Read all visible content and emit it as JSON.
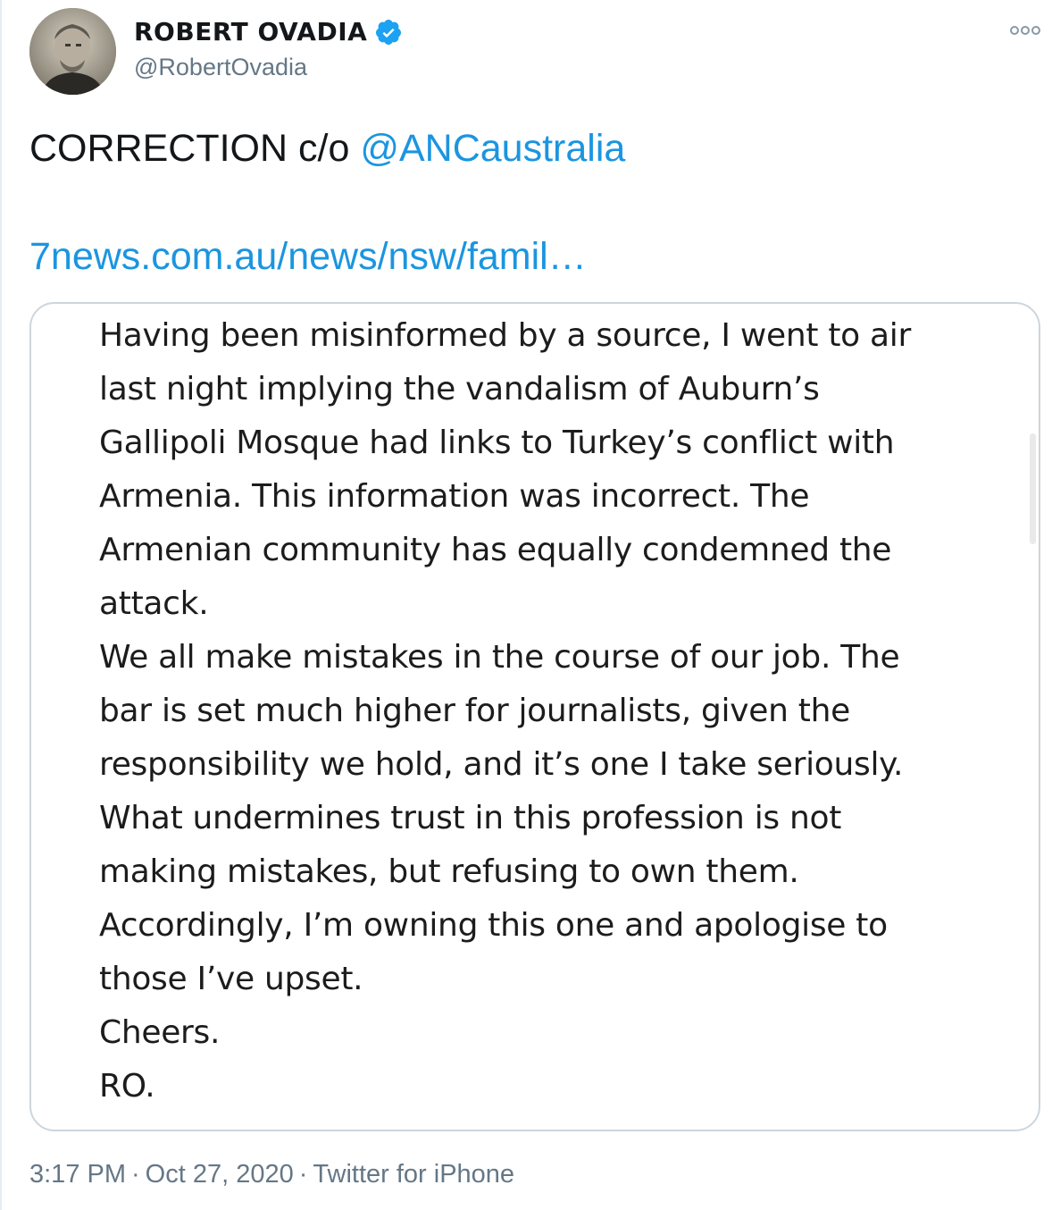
{
  "author": {
    "display_name": "ROBERT OVADIA",
    "handle": "@RobertOvadia",
    "verified": true
  },
  "tweet": {
    "text_prefix": "CORRECTION c/o ",
    "mention": "@ANCaustralia",
    "link": "7news.com.au/news/nsw/famil…"
  },
  "media": {
    "lines": [
      "Having been misinformed by a source, I went to air",
      "last night implying the vandalism of Auburn’s",
      "Gallipoli Mosque had links to Turkey’s conflict with",
      "Armenia. This information was incorrect. The",
      "Armenian community has equally condemned the",
      "attack.",
      "We all make mistakes in the course of our job. The",
      "bar is set much higher for journalists, given the",
      "responsibility we hold, and it’s one I take seriously.",
      "What undermines trust in this profession is not",
      "making mistakes, but refusing to own them.",
      "Accordingly, I’m owning this one and apologise to",
      "those I’ve upset.",
      "Cheers.",
      "RO."
    ]
  },
  "meta": {
    "time": "3:17 PM",
    "separator": "·",
    "date": "Oct 27, 2020",
    "source": "Twitter for iPhone"
  },
  "colors": {
    "link": "#1b95e0",
    "secondary_text": "#657786",
    "verified": "#1da1f2",
    "border": "#ccd6dd"
  },
  "icons": [
    "avatar",
    "verified-badge-icon",
    "more-options-icon"
  ]
}
